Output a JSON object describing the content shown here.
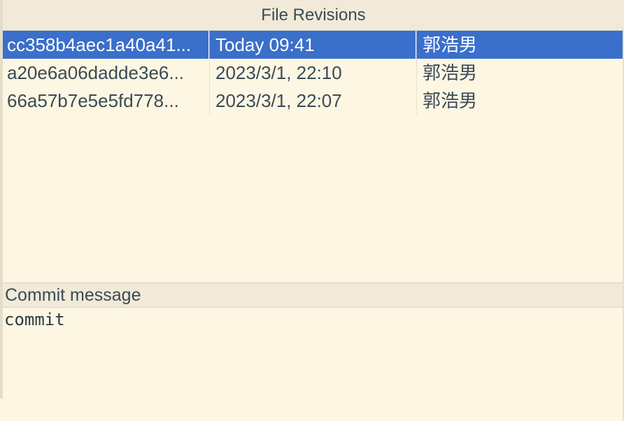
{
  "window": {
    "title": "File Revisions"
  },
  "revisions": {
    "rows": [
      {
        "hash": "cc358b4aec1a40a41...",
        "date": "Today 09:41",
        "author": "郭浩男",
        "selected": true
      },
      {
        "hash": "a20e6a06dadde3e6...",
        "date": "2023/3/1, 22:10",
        "author": "郭浩男",
        "selected": false
      },
      {
        "hash": "66a57b7e5e5fd778...",
        "date": "2023/3/1, 22:07",
        "author": "郭浩男",
        "selected": false
      }
    ]
  },
  "commit": {
    "header": "Commit message",
    "message": "commit"
  },
  "colors": {
    "background": "#fdf6e3",
    "header_background": "#f1ead9",
    "selection": "#3a6fcb",
    "text": "#3a4a55"
  }
}
